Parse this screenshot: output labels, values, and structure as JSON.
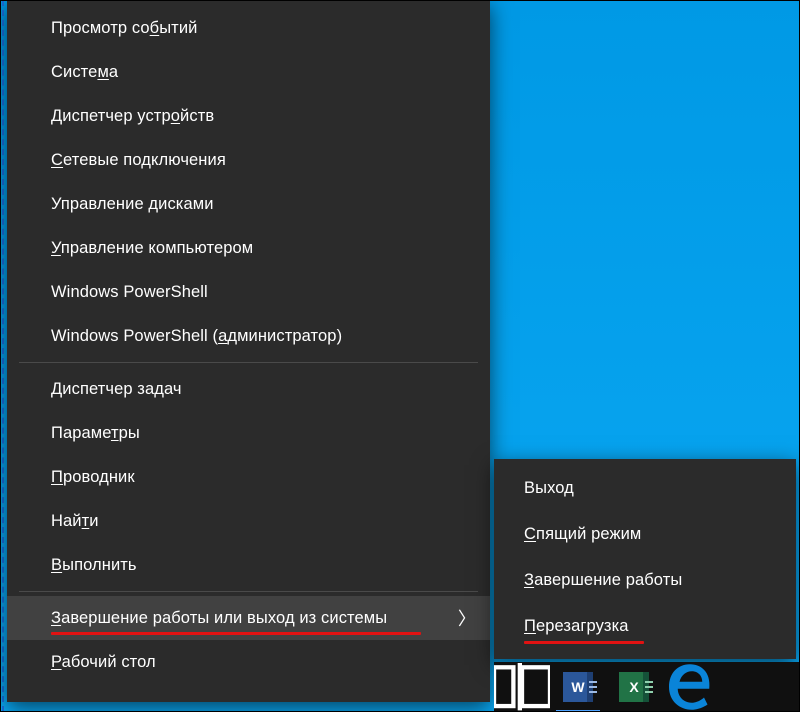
{
  "mainMenu": {
    "groups": [
      [
        {
          "label": "Просмотр событий",
          "ul": [
            11
          ]
        },
        {
          "label": "Система",
          "ul": [
            5
          ]
        },
        {
          "label": "Диспетчер устройств",
          "ul": [
            14
          ]
        },
        {
          "label": "Сетевые подключения",
          "ul": [
            0
          ]
        },
        {
          "label": "Управление дисками",
          "ul": [
            null
          ]
        },
        {
          "label": "Управление компьютером",
          "ul": [
            0
          ]
        },
        {
          "label": "Windows PowerShell",
          "ul": [
            null
          ]
        },
        {
          "label": "Windows PowerShell (администратор)",
          "ul": [
            20
          ]
        }
      ],
      [
        {
          "label": "Диспетчер задач",
          "ul": [
            0
          ]
        },
        {
          "label": "Параметры",
          "ul": [
            6
          ]
        },
        {
          "label": "Проводник",
          "ul": [
            0
          ]
        },
        {
          "label": "Найти",
          "ul": [
            3
          ]
        },
        {
          "label": "Выполнить",
          "ul": [
            0
          ]
        }
      ],
      [
        {
          "label": "Завершение работы или выход из системы",
          "ul": [
            0
          ],
          "arrow": true,
          "hovered": true,
          "redline": [
            0,
            370
          ]
        },
        {
          "label": "Рабочий стол",
          "ul": [
            0
          ]
        }
      ]
    ]
  },
  "subMenu": {
    "items": [
      {
        "label": "Выход",
        "ul": [
          null
        ]
      },
      {
        "label": "Спящий режим",
        "ul": [
          0
        ]
      },
      {
        "label": "Завершение работы",
        "ul": [
          0
        ]
      },
      {
        "label": "Перезагрузка",
        "ul": [
          0
        ],
        "redline": [
          0,
          120
        ]
      }
    ]
  },
  "taskbar": {
    "items": [
      {
        "name": "task-view-icon",
        "type": "taskview"
      },
      {
        "name": "word-icon",
        "type": "word",
        "letter": "W"
      },
      {
        "name": "excel-icon",
        "type": "excel",
        "letter": "X"
      },
      {
        "name": "edge-icon",
        "type": "edge"
      }
    ]
  }
}
